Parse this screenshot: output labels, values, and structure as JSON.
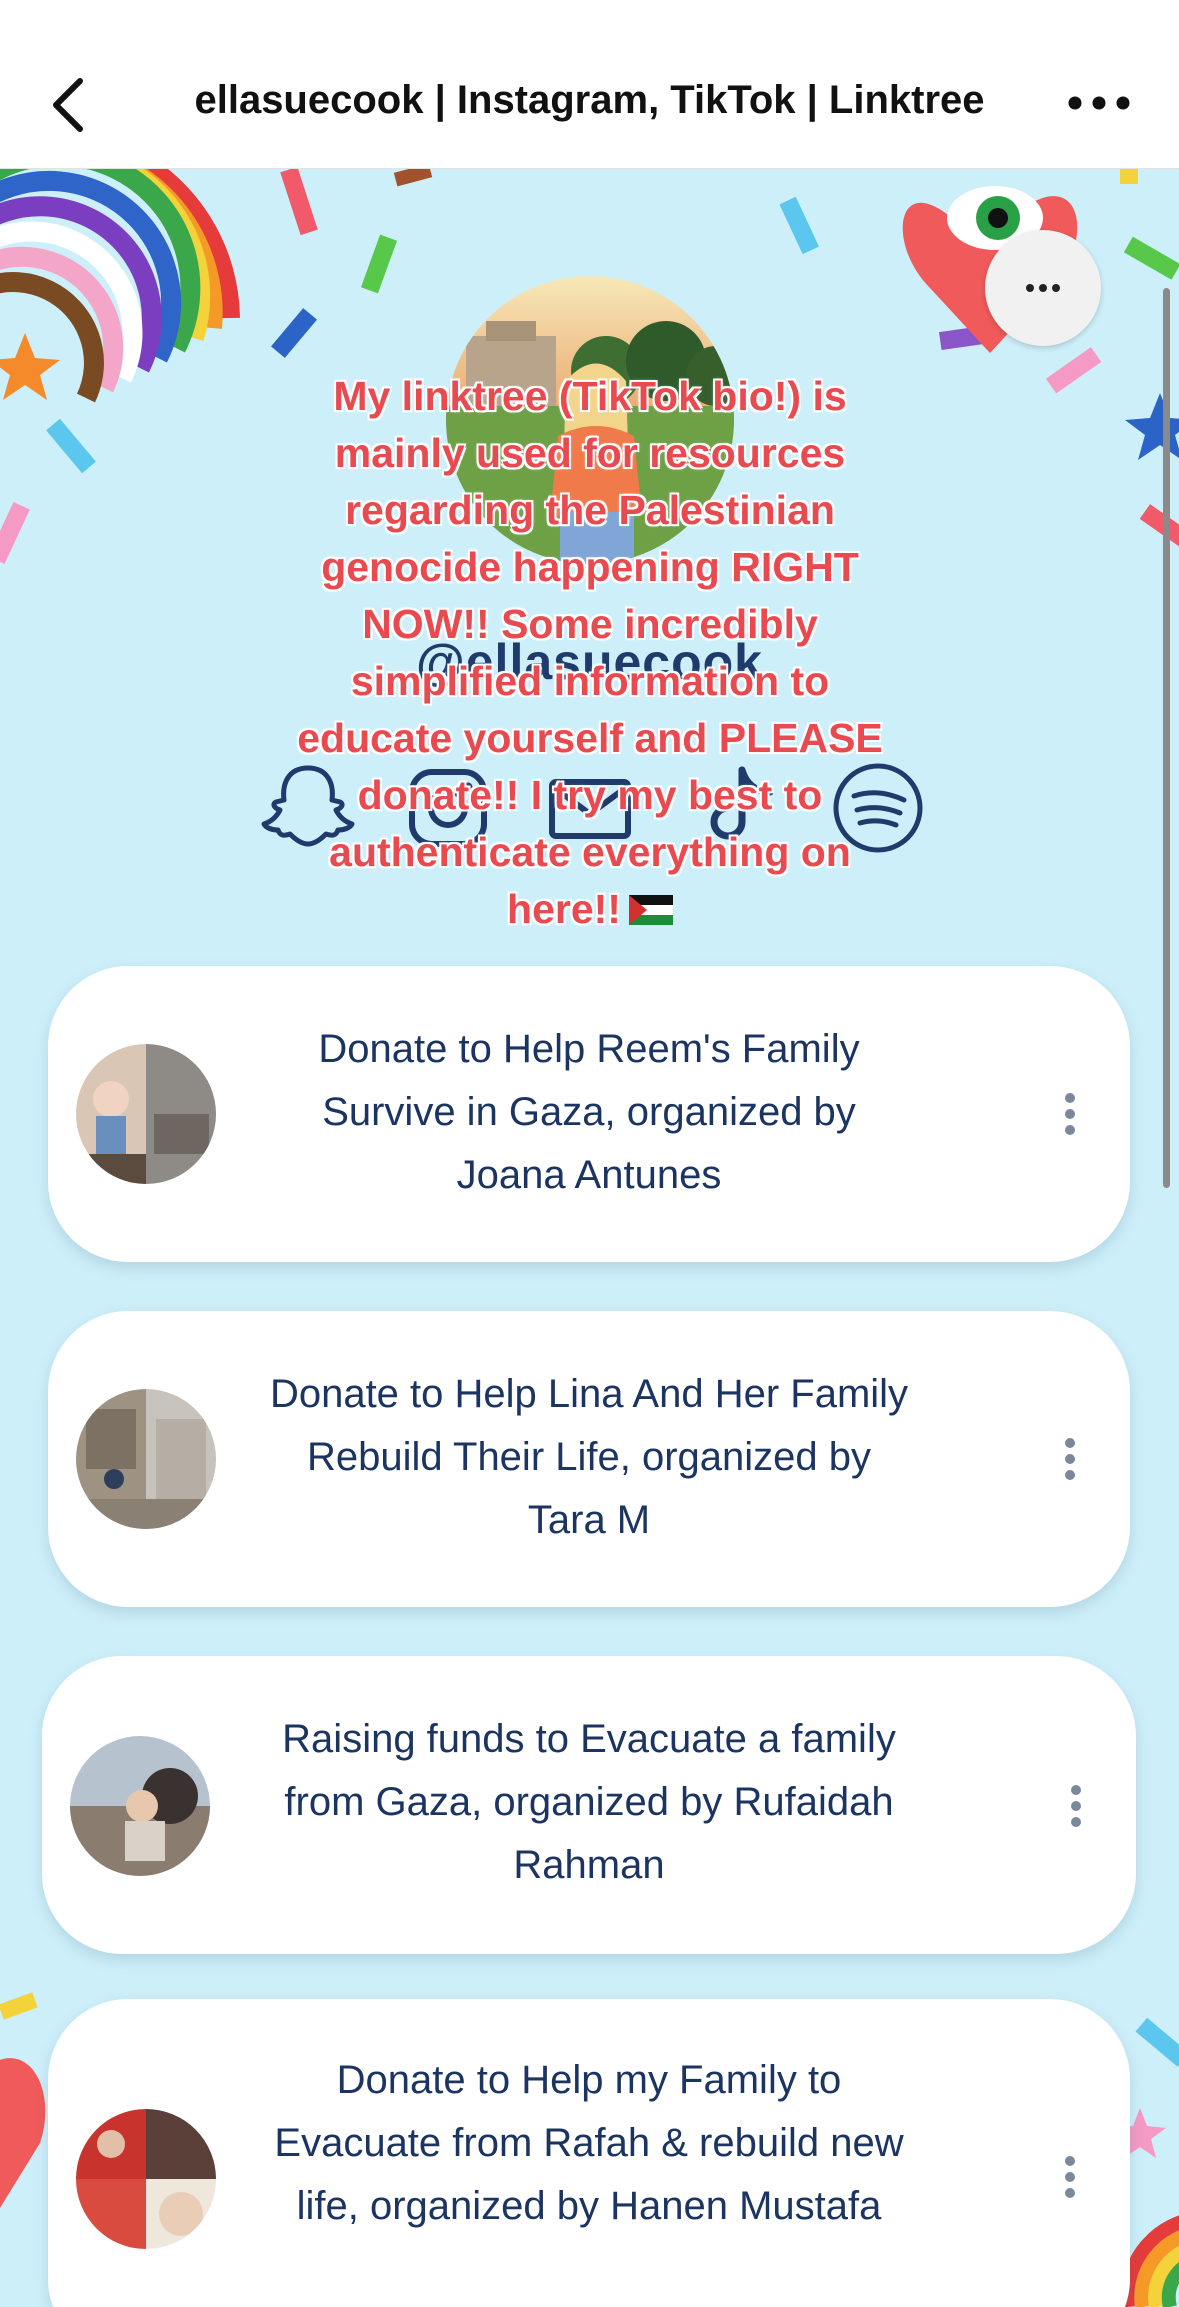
{
  "browser": {
    "title": "ellasuecook | Instagram, TikTok | Linktree"
  },
  "profile": {
    "username": "@ellasuecook",
    "bio": "My linktree (TikTok bio!) is mainly used for resources regarding the Palestinian genocide happening RIGHT NOW!! Some incredibly simplified information to educate yourself and PLEASE donate!! I try my best to authenticate everything on here!!",
    "social_icons": [
      "snapchat-icon",
      "instagram-icon",
      "email-icon",
      "tiktok-icon",
      "spotify-icon"
    ]
  },
  "links": [
    {
      "label": "Donate to Help Reem's Family Survive in Gaza, organized by Joana Antunes"
    },
    {
      "label": "Donate to Help Lina And Her Family Rebuild Their Life, organized by Tara M"
    },
    {
      "label": "Raising funds to Evacuate a family from Gaza, organized by Rufaidah Rahman"
    },
    {
      "label": "Donate to Help my Family to Evacuate from Rafah & rebuild new life, organized by Hanen Mustafa"
    }
  ],
  "colors": {
    "background": "#cdeffa",
    "bio_text": "#e84a50",
    "link_text": "#1b3461",
    "username": "#1f3a6b"
  }
}
